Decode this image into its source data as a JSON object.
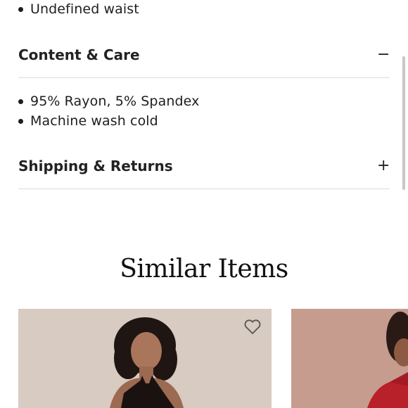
{
  "details": {
    "bullets_top": [
      "Undefined waist"
    ]
  },
  "content_care": {
    "title": "Content & Care",
    "toggle": "−",
    "bullets": [
      "95% Rayon, 5% Spandex",
      "Machine wash cold"
    ]
  },
  "shipping_returns": {
    "title": "Shipping & Returns",
    "toggle": "+"
  },
  "similar": {
    "title": "Similar Items",
    "items": [
      {
        "image": "model in black halter dress",
        "wishlist_icon": "heart-icon"
      },
      {
        "image": "model in red dress",
        "wishlist_icon": "heart-icon"
      }
    ]
  },
  "colors": {
    "text": "#1e1e1e",
    "divider": "#dcdcdc",
    "card1_bg": "#d8cbc1",
    "card2_bg": "#c69c8e",
    "dress_black": "#1a1210",
    "dress_red": "#b8202a"
  }
}
